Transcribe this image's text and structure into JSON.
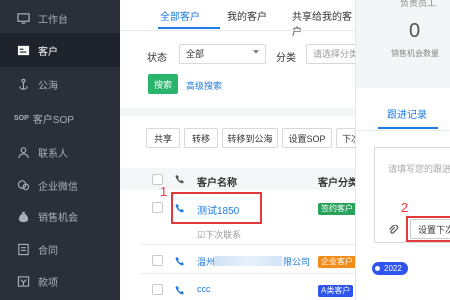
{
  "sidebar": {
    "items": [
      {
        "label": "工作台",
        "icon": "monitor-icon"
      },
      {
        "label": "客户",
        "icon": "id-card-icon"
      },
      {
        "label": "公海",
        "icon": "anchor-icon"
      },
      {
        "label": "客户SOP",
        "icon": "sop-icon"
      },
      {
        "label": "联系人",
        "icon": "person-icon"
      },
      {
        "label": "企业微信",
        "icon": "wechat-icon"
      },
      {
        "label": "销售机会",
        "icon": "money-bag-icon"
      },
      {
        "label": "合同",
        "icon": "contract-icon"
      },
      {
        "label": "款项",
        "icon": "payment-icon"
      }
    ],
    "active_index": 1
  },
  "tabs": [
    "全部客户",
    "我的客户",
    "共享给我的客户"
  ],
  "filter": {
    "status_label": "状态",
    "status_value": "全部",
    "category_label": "分类",
    "category_placeholder": "请选择分类"
  },
  "search_button": "搜索",
  "advanced_search": "高级搜索",
  "toolbar": [
    "共享",
    "转移",
    "转移到公海",
    "设置SOP",
    "下次"
  ],
  "table": {
    "headers": [
      "客户名称",
      "客户分类"
    ],
    "rows": [
      {
        "name": "测试1850",
        "badge": "签约客户",
        "badge_color": "#29a35b",
        "next_contact": "☑下次联系"
      },
      {
        "name": "温州",
        "name_suffix": "限公司",
        "badge": "企业客户",
        "badge_color": "#f08c1a"
      },
      {
        "name": "ccc",
        "badge": "A类客户",
        "badge_color": "#2f54eb"
      }
    ]
  },
  "annotations": {
    "marker1": "1",
    "marker2": "2"
  },
  "panel": {
    "header_partial": "负责员工",
    "count": "0",
    "count_label": "销售机会数量",
    "tab_active": "跟进记录",
    "textarea_placeholder": "请填写您的跟进",
    "set_next_button": "设置下次",
    "year_badge": "2022"
  },
  "colors": {
    "accent": "#1e7be0",
    "sidebar_bg": "#2b2f3a",
    "annotation_red": "#e4393c",
    "green": "#29b36b"
  }
}
